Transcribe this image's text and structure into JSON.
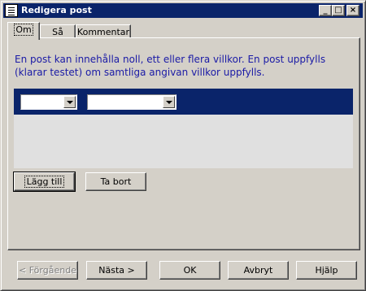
{
  "window": {
    "title": "Redigera post",
    "controls": {
      "minimize": "_",
      "maximize": "□",
      "close": "×"
    }
  },
  "tabs": [
    {
      "label": "Om",
      "active": true
    },
    {
      "label": "Så",
      "active": false
    },
    {
      "label": "Kommentar",
      "active": false
    }
  ],
  "panel": {
    "description": "En post kan innehålla noll, ett eller flera villkor. En post uppfylls (klarar testet) om samtliga angivan villkor uppfylls.",
    "condition_row": {
      "field_value": "",
      "operator_value": ""
    },
    "add_label": "Lägg till",
    "remove_label": "Ta bort"
  },
  "footer": {
    "previous_label": "< Förgående",
    "next_label": "Nästa >",
    "ok_label": "OK",
    "cancel_label": "Avbryt",
    "help_label": "Hjälp"
  }
}
